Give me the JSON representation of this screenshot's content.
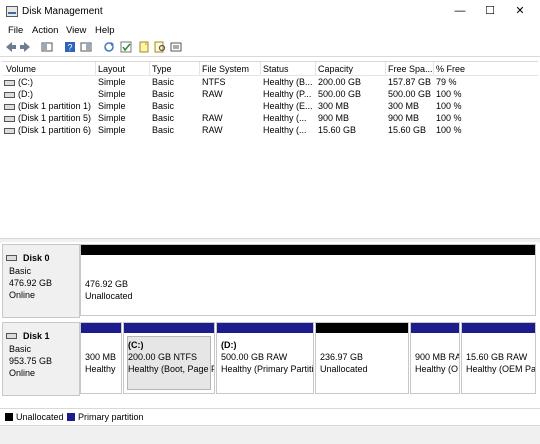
{
  "window": {
    "title": "Disk Management",
    "minimize": "—",
    "maximize": "☐",
    "close": "✕"
  },
  "menu": [
    "File",
    "Action",
    "View",
    "Help"
  ],
  "toolbar_icons": [
    "back-arrow-icon",
    "forward-arrow-icon",
    "disk-list-icon",
    "help-icon",
    "properties-icon",
    "refresh-icon",
    "check-icon",
    "new-icon",
    "search-icon",
    "settings-icon"
  ],
  "columns": [
    "Volume",
    "Layout",
    "Type",
    "File System",
    "Status",
    "Capacity",
    "Free Spa...",
    "% Free"
  ],
  "volumes": [
    {
      "volume": "(C:)",
      "layout": "Simple",
      "type": "Basic",
      "fs": "NTFS",
      "status": "Healthy (B...",
      "capacity": "200.00 GB",
      "free": "157.87 GB",
      "pct": "79 %"
    },
    {
      "volume": "(D:)",
      "layout": "Simple",
      "type": "Basic",
      "fs": "RAW",
      "status": "Healthy (P...",
      "capacity": "500.00 GB",
      "free": "500.00 GB",
      "pct": "100 %"
    },
    {
      "volume": "(Disk 1 partition 1)",
      "layout": "Simple",
      "type": "Basic",
      "fs": "",
      "status": "Healthy (E...",
      "capacity": "300 MB",
      "free": "300 MB",
      "pct": "100 %"
    },
    {
      "volume": "(Disk 1 partition 5)",
      "layout": "Simple",
      "type": "Basic",
      "fs": "RAW",
      "status": "Healthy (...",
      "capacity": "900 MB",
      "free": "900 MB",
      "pct": "100 %"
    },
    {
      "volume": "(Disk 1 partition 6)",
      "layout": "Simple",
      "type": "Basic",
      "fs": "RAW",
      "status": "Healthy (...",
      "capacity": "15.60 GB",
      "free": "15.60 GB",
      "pct": "100 %"
    }
  ],
  "disks": [
    {
      "name": "Disk 0",
      "type": "Basic",
      "size": "476.92 GB",
      "state": "Online",
      "partitions": [
        {
          "title": "",
          "line1": "476.92 GB",
          "line2": "Unallocated",
          "kind": "unalloc"
        }
      ]
    },
    {
      "name": "Disk 1",
      "type": "Basic",
      "size": "953.75 GB",
      "state": "Online",
      "partitions": [
        {
          "title": "",
          "line1": "300 MB",
          "line2": "Healthy",
          "kind": "primary"
        },
        {
          "title": "(C:)",
          "line1": "200.00 GB NTFS",
          "line2": "Healthy (Boot, Page F",
          "kind": "primary"
        },
        {
          "title": "(D:)",
          "line1": "500.00 GB RAW",
          "line2": "Healthy (Primary Partiti",
          "kind": "primary"
        },
        {
          "title": "",
          "line1": "236.97 GB",
          "line2": "Unallocated",
          "kind": "unalloc"
        },
        {
          "title": "",
          "line1": "900 MB RA",
          "line2": "Healthy (O",
          "kind": "primary"
        },
        {
          "title": "",
          "line1": "15.60 GB RAW",
          "line2": "Healthy (OEM Pa",
          "kind": "primary"
        }
      ]
    }
  ],
  "legend": [
    {
      "label": "Unallocated",
      "color": "#000000"
    },
    {
      "label": "Primary partition",
      "color": "#1c1c8c"
    }
  ],
  "colors": {
    "primary": "#1c1c8c",
    "unallocated": "#000000",
    "selection": "#e6e6e6"
  }
}
